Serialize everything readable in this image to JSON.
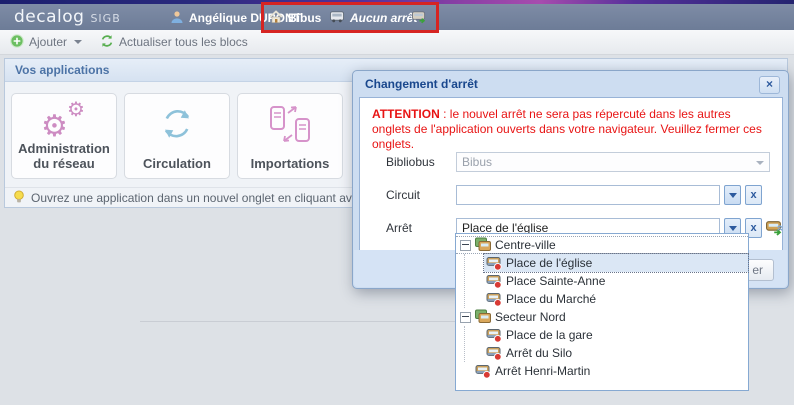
{
  "app": {
    "logo": "decalog",
    "logo_suffix": "SIGB"
  },
  "header": {
    "user_name": "Angélique DUPONT",
    "site_name": "Bibus",
    "current_stop": "Aucun arrêt"
  },
  "toolbar": {
    "add_label": "Ajouter",
    "refresh_label": "Actualiser tous les blocs"
  },
  "applications_panel": {
    "title": "Vos applications",
    "cards": [
      {
        "label": "Administration du réseau",
        "icon": "gears-icon"
      },
      {
        "label": "Circulation",
        "icon": "sync-arrows-icon"
      },
      {
        "label": "Importations",
        "icon": "transfer-icon"
      }
    ],
    "tip": "Ouvrez une application dans un nouvel onglet en cliquant avec la mol"
  },
  "dialog": {
    "title": "Changement d'arrêt",
    "warning_bold": "ATTENTION",
    "warning_rest": " : le nouvel arrêt ne sera pas répercuté dans les autres onglets de l'application ouverts dans votre navigateur. Veuillez fermer ces onglets.",
    "fields": {
      "bibliobus": {
        "label": "Bibliobus",
        "value": "Bibus",
        "state": "disabled"
      },
      "circuit": {
        "label": "Circuit",
        "value": ""
      },
      "arret": {
        "label": "Arrêt",
        "value": "Place de l'église"
      }
    },
    "footer_button_visible_label": "er"
  },
  "stop_dropdown": {
    "tree": [
      {
        "label": "Centre-ville",
        "type": "group",
        "level": 0,
        "expanded": true
      },
      {
        "label": "Place de l'église",
        "type": "stop",
        "level": 1,
        "selected": true
      },
      {
        "label": "Place Sainte-Anne",
        "type": "stop",
        "level": 1
      },
      {
        "label": "Place du Marché",
        "type": "stop",
        "level": 1
      },
      {
        "label": "Secteur Nord",
        "type": "group",
        "level": 0,
        "expanded": true
      },
      {
        "label": "Place de la gare",
        "type": "stop",
        "level": 1
      },
      {
        "label": "Arrêt du Silo",
        "type": "stop",
        "level": 1
      },
      {
        "label": "Arrêt Henri-Martin",
        "type": "stop",
        "level": 0
      }
    ]
  },
  "glyphs": {
    "close": "×",
    "clear": "x",
    "collapse": "«",
    "gear": "⚙"
  },
  "colors": {
    "annotation_red": "#d62422",
    "warning_red": "#e81414",
    "header_blue_gray": "#74829c",
    "dialog_title_blue": "#19478d",
    "panel_title_blue": "#4c73a6"
  }
}
